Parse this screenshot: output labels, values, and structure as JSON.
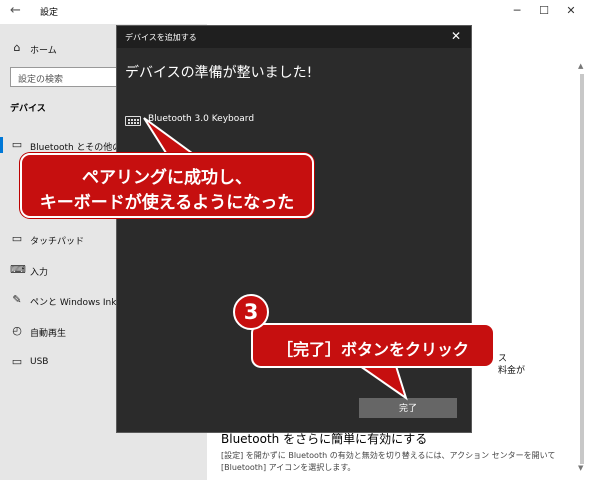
{
  "window": {
    "back_icon": "back-arrow-icon",
    "title": "設定",
    "controls": {
      "minimize": "─",
      "maximize": "☐",
      "close": "✕"
    }
  },
  "sidebar": {
    "home_label": "ホーム",
    "search_placeholder": "設定の検索",
    "section_heading": "デバイス",
    "items": [
      {
        "label": "Bluetooth とその他のデ",
        "icon": "bluetooth-devices-icon",
        "selected": true
      },
      {
        "label": "タッチパッド",
        "icon": "touchpad-icon"
      },
      {
        "label": "入力",
        "icon": "keyboard-icon"
      },
      {
        "label": "ペンと Windows Ink",
        "icon": "pen-icon"
      },
      {
        "label": "自動再生",
        "icon": "autoplay-icon"
      },
      {
        "label": "USB",
        "icon": "usb-icon"
      }
    ]
  },
  "content": {
    "fragment_1": "ス",
    "fragment_2": "料金が",
    "section_title": "Bluetooth をさらに簡単に有効にする",
    "body_line_1": "[設定] を開かずに Bluetooth の有効と無効を切り替えるには、アクション センターを開いて",
    "body_line_2": "[Bluetooth] アイコンを選択します。"
  },
  "dialog": {
    "title": "デバイスを追加する",
    "close_icon": "close-icon",
    "heading": "デバイスの準備が整いました!",
    "device_name": "Bluetooth 3.0 Keyboard",
    "device_icon": "keyboard-icon",
    "done_label": "完了"
  },
  "annotations": {
    "callout_1_line_1": "ペアリングに成功し、",
    "callout_1_line_2": "キーボードが使えるようになった",
    "step_number": "3",
    "callout_2": "［完了］ボタンをクリック",
    "color": "#c60f0f"
  }
}
